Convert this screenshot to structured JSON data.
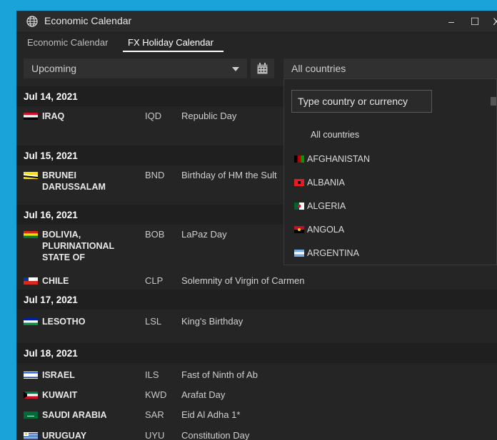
{
  "window": {
    "title": "Economic Calendar",
    "controls": {
      "minimize": "–",
      "maximize": "☐",
      "close": "X"
    }
  },
  "tabs": [
    {
      "label": "Economic Calendar",
      "active": false
    },
    {
      "label": "FX Holiday Calendar",
      "active": true
    }
  ],
  "filters": {
    "period": "Upcoming",
    "countries": "All countries"
  },
  "dropdown": {
    "search_placeholder": "Type country or currency",
    "items": [
      {
        "label": "All countries"
      },
      {
        "label": "AFGHANISTAN"
      },
      {
        "label": "ALBANIA"
      },
      {
        "label": "ALGERIA"
      },
      {
        "label": "ANGOLA"
      },
      {
        "label": "ARGENTINA"
      }
    ]
  },
  "calendar": [
    {
      "date": "Jul 14, 2021",
      "items": [
        {
          "country": "IRAQ",
          "currency": "IQD",
          "holiday": "Republic Day"
        }
      ]
    },
    {
      "date": "Jul 15, 2021",
      "items": [
        {
          "country": "BRUNEI DARUSSALAM",
          "country_l1": "BRUNEI",
          "country_l2": "DARUSSALAM",
          "currency": "BND",
          "holiday": "Birthday of HM the Sult"
        }
      ]
    },
    {
      "date": "Jul 16, 2021",
      "items": [
        {
          "country_l1": "BOLIVIA,",
          "country_l2": "PLURINATIONAL",
          "country_l3": "STATE OF",
          "currency": "BOB",
          "holiday": "LaPaz Day"
        },
        {
          "country": "CHILE",
          "currency": "CLP",
          "holiday": "Solemnity of Virgin of Carmen"
        }
      ]
    },
    {
      "date": "Jul 17, 2021",
      "items": [
        {
          "country": "LESOTHO",
          "currency": "LSL",
          "holiday": "King's Birthday"
        }
      ]
    },
    {
      "date": "Jul 18, 2021",
      "items": [
        {
          "country": "ISRAEL",
          "currency": "ILS",
          "holiday": "Fast of Ninth of Ab"
        },
        {
          "country": "KUWAIT",
          "currency": "KWD",
          "holiday": "Arafat Day"
        },
        {
          "country": "SAUDI ARABIA",
          "currency": "SAR",
          "holiday": "Eid Al Adha 1*"
        },
        {
          "country": "URUGUAY",
          "currency": "UYU",
          "holiday": "Constitution Day"
        }
      ]
    }
  ]
}
